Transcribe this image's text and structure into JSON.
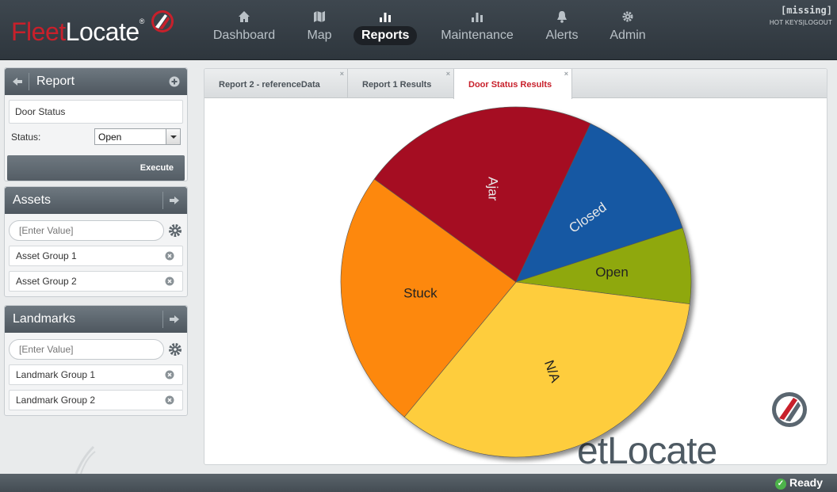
{
  "app": {
    "logo_fleet": "Fleet",
    "logo_locate": "Locate",
    "logo_reg": "®",
    "brand_red": "#c8202b"
  },
  "nav": [
    {
      "label": "Dashboard",
      "icon": "home-icon"
    },
    {
      "label": "Map",
      "icon": "map-icon"
    },
    {
      "label": "Reports",
      "icon": "bar-chart-icon",
      "active": true
    },
    {
      "label": "Maintenance",
      "icon": "bar-chart-icon"
    },
    {
      "label": "Alerts",
      "icon": "bell-icon"
    },
    {
      "label": "Admin",
      "icon": "gear-icon"
    }
  ],
  "user": {
    "name": "[missing]",
    "hotkeys": "HOT KEYS",
    "sep": "|",
    "logout": "LOGOUT"
  },
  "report_panel": {
    "title": "Report",
    "report_name": "Door Status",
    "status_label": "Status:",
    "status_value": "Open",
    "execute": "Execute"
  },
  "assets_panel": {
    "title": "Assets",
    "placeholder": "[Enter Value]",
    "items": [
      "Asset Group 1",
      "Asset Group 2"
    ]
  },
  "landmarks_panel": {
    "title": "Landmarks",
    "placeholder": "[Enter Value]",
    "items": [
      "Landmark Group 1",
      "Landmark Group 2"
    ]
  },
  "tabs": [
    {
      "label": "Report 2 - referenceData",
      "close": "×"
    },
    {
      "label": "Report 1 Results",
      "close": "×"
    },
    {
      "label": "Door Status Results",
      "close": "×",
      "active": true
    }
  ],
  "watermark": {
    "text": "etLocate",
    "reg": "®"
  },
  "chart_data": {
    "type": "pie",
    "slices": [
      {
        "label": "Ajar",
        "value": 22,
        "color": "#a51120"
      },
      {
        "label": "Closed",
        "value": 13,
        "color": "#1459a3"
      },
      {
        "label": "Open",
        "value": 7,
        "color": "#8fa80a"
      },
      {
        "label": "N/A",
        "value": 34,
        "color": "#fecd3c"
      },
      {
        "label": "Stuck",
        "value": 24,
        "color": "#fd8808"
      }
    ]
  },
  "status": {
    "text": "Ready",
    "icon": "check-icon",
    "color": "#4db34a"
  }
}
